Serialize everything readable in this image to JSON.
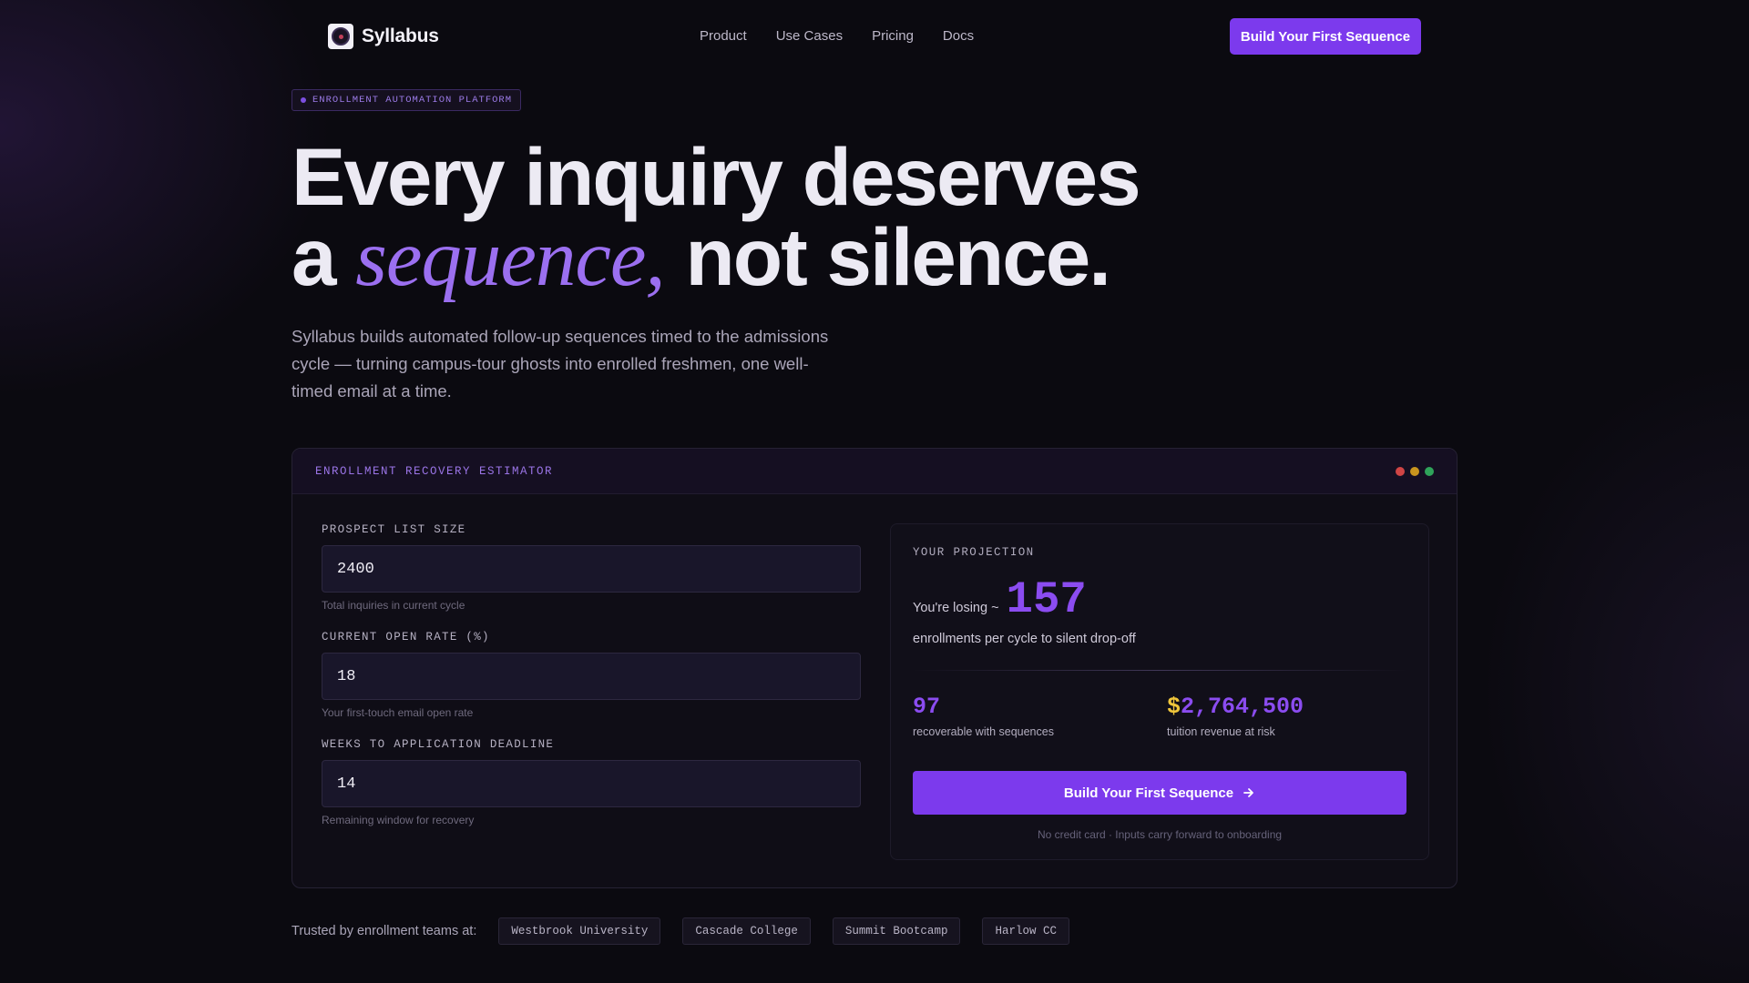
{
  "nav": {
    "brand": "Syllabus",
    "links": [
      "Product",
      "Use Cases",
      "Pricing",
      "Docs"
    ],
    "cta": "Build Your First Sequence"
  },
  "hero": {
    "badge": "ENROLLMENT AUTOMATION PLATFORM",
    "headline_line1": "Every inquiry deserves",
    "headline_a": "a",
    "headline_em": "sequence,",
    "headline_end": "not silence.",
    "subtitle": "Syllabus builds automated follow-up sequences timed to the admissions cycle — turning campus-tour ghosts into enrolled freshmen, one well-timed email at a time."
  },
  "estimator": {
    "title": "ENROLLMENT RECOVERY ESTIMATOR",
    "window_dots": [
      "#d04545",
      "#c9951e",
      "#2fa35a"
    ],
    "fields": [
      {
        "label": "PROSPECT LIST SIZE",
        "value": "2400",
        "hint": "Total inquiries in current cycle"
      },
      {
        "label": "CURRENT OPEN RATE (%)",
        "value": "18",
        "hint": "Your first-touch email open rate"
      },
      {
        "label": "WEEKS TO APPLICATION DEADLINE",
        "value": "14",
        "hint": "Remaining window for recovery"
      }
    ],
    "projection": {
      "label": "YOUR PROJECTION",
      "losing_prefix": "You're losing ~",
      "losing_value": "157",
      "losing_suffix": "enrollments per cycle to silent drop-off",
      "recoverable_value": "97",
      "recoverable_label": "recoverable with sequences",
      "revenue_currency": "$",
      "revenue_value": "2,764,500",
      "revenue_label": "tuition revenue at risk",
      "cta": "Build Your First Sequence",
      "cta_icon": "arrow-right-icon",
      "note": "No credit card · Inputs carry forward to onboarding"
    }
  },
  "trusted": {
    "label": "Trusted by enrollment teams at:",
    "logos": [
      "Westbrook University",
      "Cascade College",
      "Summit Bootcamp",
      "Harlow CC"
    ]
  },
  "colors": {
    "accent": "#7c3aed",
    "accent_text": "#8b4cf0",
    "currency": "#f0c63b",
    "background": "#0b0a10"
  }
}
